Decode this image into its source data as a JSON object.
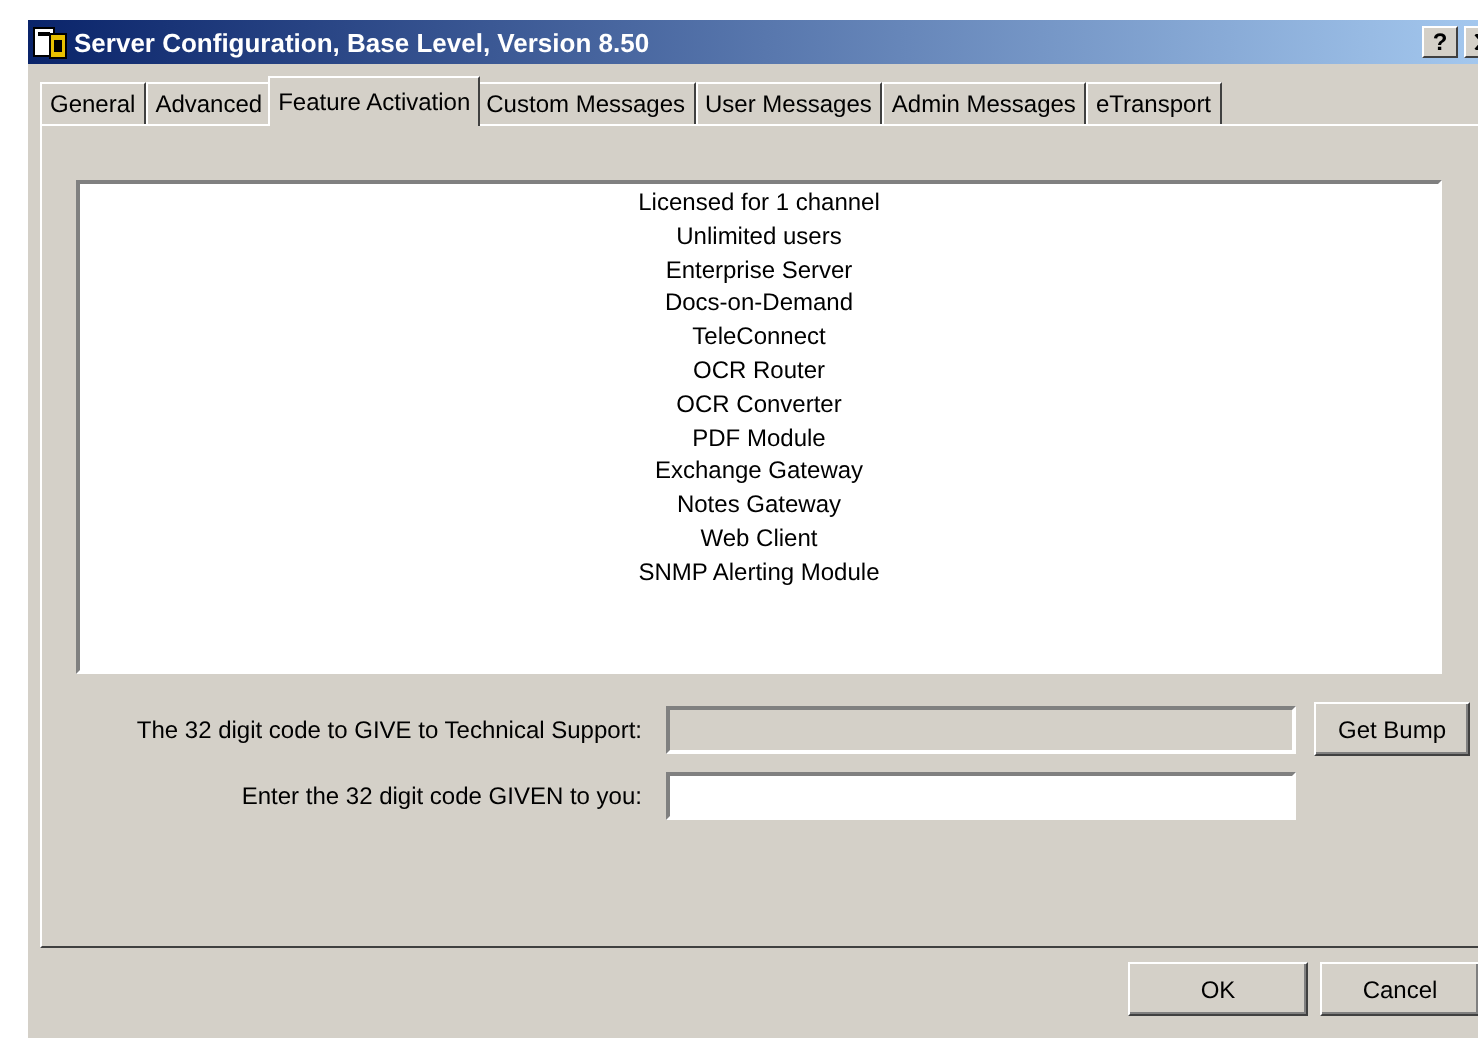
{
  "window": {
    "title": "Server Configuration, Base Level, Version 8.50",
    "help_button": "?"
  },
  "tabs": [
    {
      "label": "General",
      "selected": false
    },
    {
      "label": "Advanced",
      "selected": false
    },
    {
      "label": "Feature Activation",
      "selected": true
    },
    {
      "label": "Custom Messages",
      "selected": false
    },
    {
      "label": "User Messages",
      "selected": false
    },
    {
      "label": "Admin Messages",
      "selected": false
    },
    {
      "label": "eTransport",
      "selected": false
    }
  ],
  "features": [
    "Licensed for 1 channel",
    "Unlimited users",
    "Enterprise Server",
    "Docs-on-Demand",
    "TeleConnect",
    "OCR Router",
    "OCR Converter",
    "PDF Module",
    "Exchange Gateway",
    "Notes Gateway",
    "Web Client",
    "SNMP Alerting Module"
  ],
  "code_fields": [
    {
      "label": "The 32 digit code to GIVE to Technical Support:",
      "disabled": true,
      "button": "Get Bump"
    },
    {
      "label": "Enter the 32 digit code GIVEN to you:",
      "disabled": false
    }
  ],
  "buttons": [
    "OK",
    "Cancel"
  ]
}
